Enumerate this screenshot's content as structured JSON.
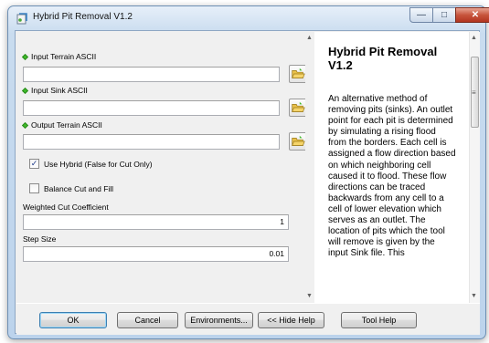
{
  "window": {
    "title": "Hybrid Pit Removal V1.2",
    "controls": {
      "minimize": "—",
      "maximize": "□",
      "close": "✕"
    }
  },
  "form": {
    "input_terrain": {
      "label": "Input Terrain ASCII",
      "value": ""
    },
    "input_sink": {
      "label": "Input Sink ASCII",
      "value": ""
    },
    "output_terrain": {
      "label": "Output Terrain ASCII",
      "value": ""
    },
    "use_hybrid": {
      "label": "Use Hybrid (False for Cut Only)",
      "checked": true,
      "mark": "✓"
    },
    "balance": {
      "label": "Balance Cut and Fill",
      "checked": false,
      "mark": ""
    },
    "weighted_cut": {
      "label": "Weighted Cut Coefficient",
      "value": "1"
    },
    "step_size": {
      "label": "Step Size",
      "value": "0.01"
    }
  },
  "scroll": {
    "up": "▲",
    "down": "▼",
    "help_up": "▲",
    "help_down": "▼",
    "grip": "≡"
  },
  "help": {
    "title": "Hybrid Pit Removal V1.2",
    "body": "An alternative method of removing pits (sinks). An outlet point for each pit is determined by simulating a rising flood from the borders. Each cell is assigned a flow direction based on which neighboring cell caused it to flood. These flow directions can be traced backwards from any cell to a cell of lower elevation which serves as an outlet. The location of pits which the tool will remove is given by the input Sink file. This"
  },
  "buttons": {
    "ok": "OK",
    "cancel": "Cancel",
    "environments": "Environments...",
    "hide_help": "<< Hide Help",
    "tool_help": "Tool Help"
  },
  "colors": {
    "required_dot": "#3fbb2a",
    "close_button": "#c7543c"
  }
}
